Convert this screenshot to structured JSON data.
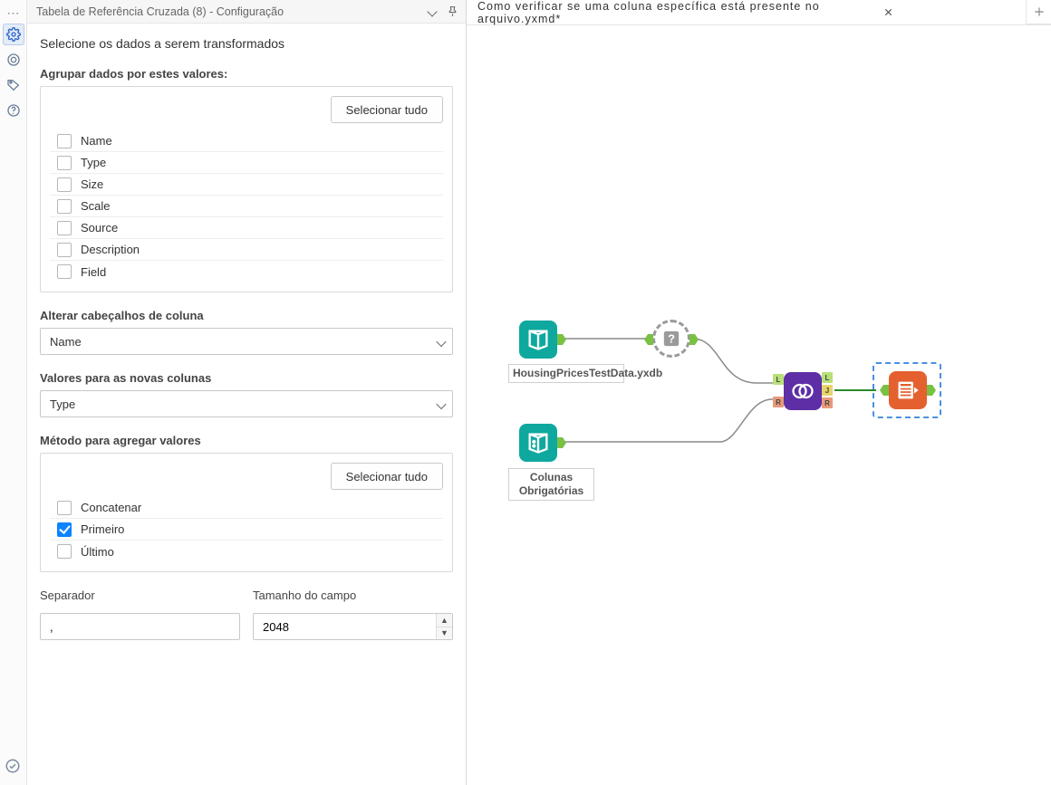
{
  "panel": {
    "title": "Tabela de Referência Cruzada (8) - Configuração",
    "heading": "Selecione os dados a serem transformados",
    "group_label": "Agrupar dados por estes valores:",
    "select_all": "Selecionar tudo",
    "group_items": [
      {
        "label": "Name",
        "checked": false
      },
      {
        "label": "Type",
        "checked": false
      },
      {
        "label": "Size",
        "checked": false
      },
      {
        "label": "Scale",
        "checked": false
      },
      {
        "label": "Source",
        "checked": false
      },
      {
        "label": "Description",
        "checked": false
      },
      {
        "label": "Field",
        "checked": false
      }
    ],
    "header_label": "Alterar cabeçalhos de coluna",
    "header_value": "Name",
    "values_label": "Valores para as novas colunas",
    "values_value": "Type",
    "agg_label": "Método para agregar valores",
    "agg_items": [
      {
        "label": "Concatenar",
        "checked": false
      },
      {
        "label": "Primeiro",
        "checked": true
      },
      {
        "label": "Último",
        "checked": false
      }
    ],
    "sep_label": "Separador",
    "sep_value": ",",
    "size_label": "Tamanho do campo",
    "size_value": "2048"
  },
  "workspace": {
    "tab_title": "Como verificar se uma coluna específica está presente no arquivo.yxmd*",
    "nodes": {
      "input1_label": "HousingPricesTestData.yxdb",
      "input2_label": "Colunas Obrigatórias"
    }
  },
  "anchor_labels": {
    "L": "L",
    "J": "J",
    "R": "R"
  }
}
